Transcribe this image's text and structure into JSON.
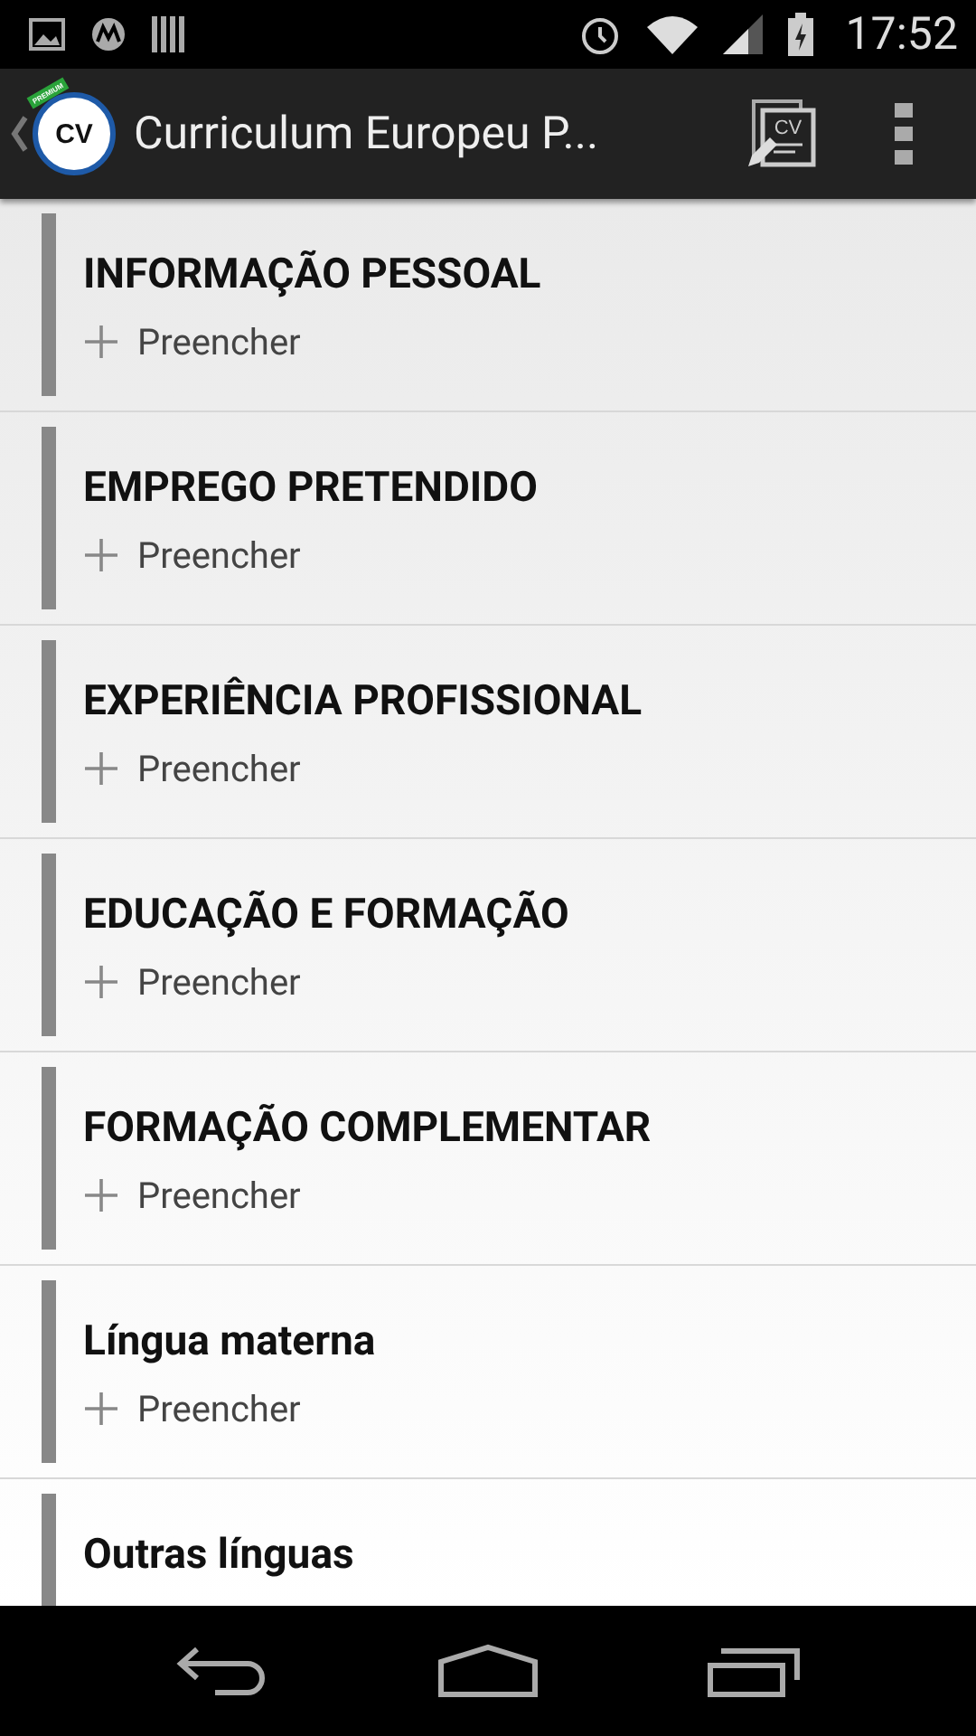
{
  "status_bar": {
    "time": "17:52"
  },
  "app_bar": {
    "logo_text": "CV",
    "logo_badge": "PREMIUM",
    "title": "Curriculum Europeu P...",
    "edit_icon_text": "CV"
  },
  "sections": [
    {
      "title": "INFORMAÇÃO PESSOAL",
      "action": "Preencher"
    },
    {
      "title": "EMPREGO PRETENDIDO",
      "action": "Preencher"
    },
    {
      "title": "EXPERIÊNCIA PROFISSIONAL",
      "action": "Preencher"
    },
    {
      "title": "EDUCAÇÃO E FORMAÇÃO",
      "action": "Preencher"
    },
    {
      "title": "FORMAÇÃO COMPLEMENTAR",
      "action": "Preencher"
    },
    {
      "title": "Língua materna",
      "action": "Preencher"
    },
    {
      "title": "Outras línguas"
    }
  ]
}
